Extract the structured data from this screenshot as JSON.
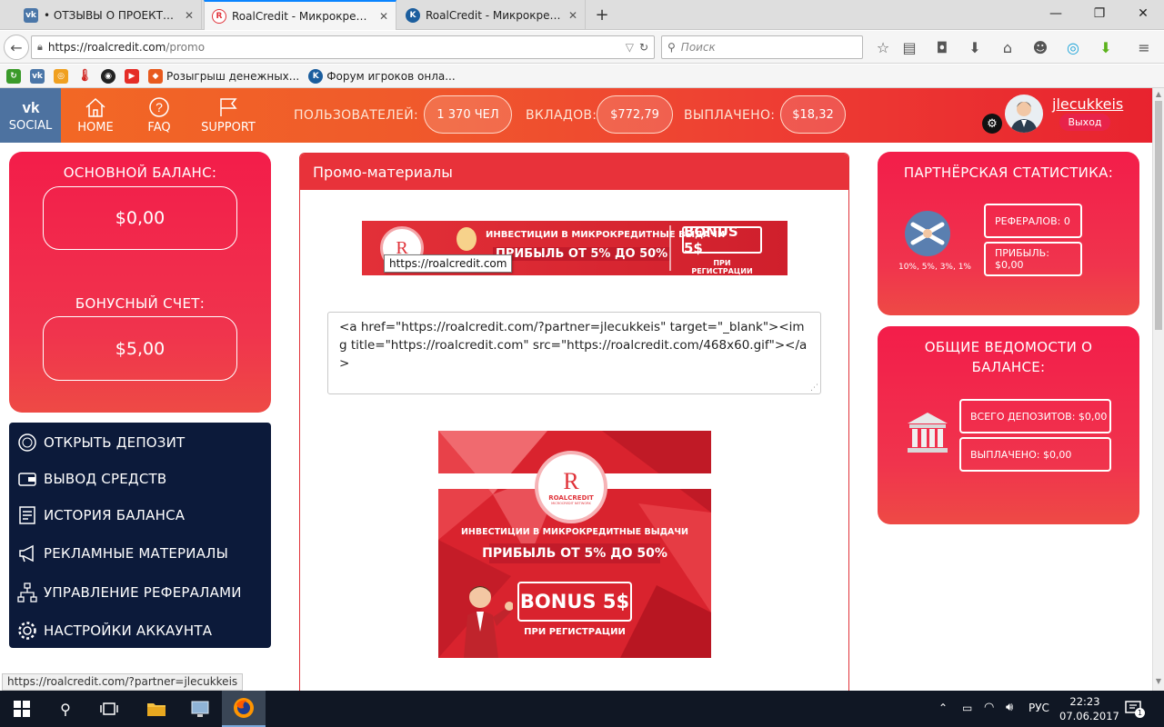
{
  "browser": {
    "tabs": [
      {
        "title": "• ОТЗЫВЫ О ПРОЕКТЕ/ С...",
        "icon": "vk-icon",
        "active": false
      },
      {
        "title": "RoalCredit - Микрокредит...",
        "icon": "roalcredit-icon",
        "active": true
      },
      {
        "title": "RoalCredit - Микрокредит...",
        "icon": "forum-icon",
        "active": false
      }
    ],
    "url_host": "https://roalcredit.com",
    "url_path": "/promo",
    "search_placeholder": "Поиск",
    "bookmarks": [
      {
        "label": "",
        "icon": "green-refresh-icon"
      },
      {
        "label": "",
        "icon": "vk-icon"
      },
      {
        "label": "",
        "icon": "odnoklassniki-icon"
      },
      {
        "label": "",
        "icon": "thermometer-icon"
      },
      {
        "label": "",
        "icon": "ninja-icon"
      },
      {
        "label": "",
        "icon": "youtube-icon"
      },
      {
        "label": "Розыгрыш денежных...",
        "icon": "gift-icon"
      },
      {
        "label": "Форум игроков онла...",
        "icon": "forum-icon"
      }
    ],
    "status_url": "https://roalcredit.com/?partner=jlecukkeis"
  },
  "header": {
    "social_label": "SOCIAL",
    "home_label": "HOME",
    "faq_label": "FAQ",
    "support_label": "SUPPORT",
    "users_label": "ПОЛЬЗОВАТЕЛЕЙ:",
    "users_value": "1 370 ЧЕЛ",
    "deposits_label": "ВКЛАДОВ:",
    "deposits_value": "$772,79",
    "paid_label": "ВЫПЛАЧЕНО:",
    "paid_value": "$18,32",
    "username": "jlecukkeis",
    "logout_label": "Выход"
  },
  "left": {
    "main_balance_title": "ОСНОВНОЙ БАЛАНС:",
    "main_balance_value": "$0,00",
    "bonus_title": "БОНУСНЫЙ СЧЕТ:",
    "bonus_value": "$5,00",
    "menu": [
      {
        "label": "ОТКРЫТЬ ДЕПОЗИТ",
        "icon": "deposit-icon"
      },
      {
        "label": "ВЫВОД СРЕДСТВ",
        "icon": "wallet-icon"
      },
      {
        "label": "ИСТОРИЯ БАЛАНСА",
        "icon": "history-icon"
      },
      {
        "label": "РЕКЛАМНЫЕ МАТЕРИАЛЫ",
        "icon": "megaphone-icon"
      },
      {
        "label": "УПРАВЛЕНИЕ РЕФЕРАЛАМИ",
        "icon": "hierarchy-icon"
      },
      {
        "label": "НАСТРОЙКИ АККАУНТА",
        "icon": "gear-icon"
      }
    ]
  },
  "main": {
    "title": "Промо-материалы",
    "banner_small": {
      "logo_letter": "R",
      "line1": "ИНВЕСТИЦИИ В МИКРОКРЕДИТНЫЕ ВЫДАЧИ",
      "line2": "ПРИБЫЛЬ ОТ 5% ДО 50%",
      "bonus": "BONUS 5$",
      "bonus_sub": "ПРИ РЕГИСТРАЦИИ",
      "tooltip": "https://roalcredit.com"
    },
    "code_snippet": "<a href=\"https://roalcredit.com/?partner=jlecukkeis\" target=\"_blank\"><img title=\"https://roalcredit.com\" src=\"https://roalcredit.com/468x60.gif\"></a>",
    "banner_large": {
      "logo_letter": "R",
      "brand": "ROALCREDIT",
      "brand_sub": "MICROCREDIT NETWORK",
      "line1": "ИНВЕСТИЦИИ В МИКРОКРЕДИТНЫЕ ВЫДАЧИ",
      "line2": "ПРИБЫЛЬ ОТ 5% ДО 50%",
      "bonus": "BONUS 5$",
      "bonus_sub": "ПРИ РЕГИСТРАЦИИ"
    }
  },
  "right": {
    "partner_title": "ПАРТНЁРСКАЯ СТАТИСТИКА:",
    "partner_levels": "10%, 5%, 3%, 1%",
    "referrals": "РЕФЕРАЛОВ: 0",
    "profit": "ПРИБЫЛЬ: $0,00",
    "balance_title": "ОБЩИЕ ВЕДОМОСТИ О БАЛАНСЕ:",
    "total_deposits": "ВСЕГО ДЕПОЗИТОВ: $0,00",
    "paid_out": "ВЫПЛАЧЕНО: $0,00"
  },
  "taskbar": {
    "lang": "РУС",
    "time": "22:23",
    "date": "07.06.2017",
    "notifications": "1"
  },
  "colors": {
    "accent_red": "#e8323a",
    "panel_red": "#f31d4a",
    "header_orange": "#f26a24",
    "menu_navy": "#0c1a3a"
  }
}
